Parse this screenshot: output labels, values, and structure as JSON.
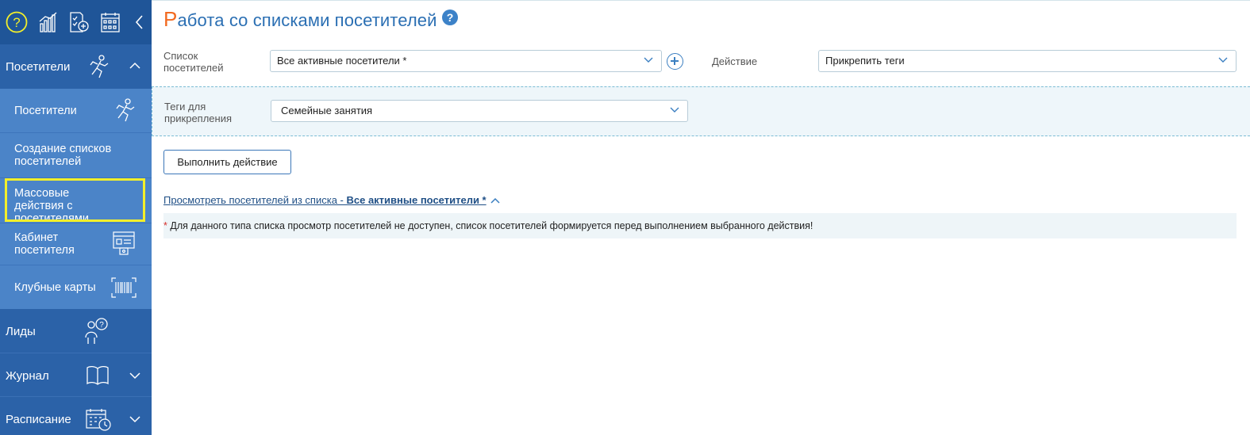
{
  "sidebar": {
    "toolbar": {
      "icons": [
        "help-icon",
        "stats-icon",
        "document-add-icon",
        "calendar-grid-icon",
        "collapse-arrow-icon"
      ]
    },
    "items": [
      {
        "label": "Посетители",
        "icon": "running-person-icon",
        "expanded": true
      },
      {
        "label": "Посетители",
        "icon": "running-person-icon"
      },
      {
        "label": "Создание списков посетителей"
      },
      {
        "label": "Массовые действия с посетителями",
        "highlighted": true
      },
      {
        "label": "Кабинет посетителя",
        "icon": "cabinet-icon"
      },
      {
        "label": "Клубные карты",
        "icon": "barcode-icon"
      },
      {
        "label": "Лиды",
        "icon": "person-question-icon"
      },
      {
        "label": "Журнал",
        "icon": "book-icon"
      },
      {
        "label": "Расписание",
        "icon": "schedule-icon"
      }
    ]
  },
  "page": {
    "title_first": "Р",
    "title_rest": "абота со списками посетителей",
    "help": "?"
  },
  "form": {
    "list_label": "Список посетителей",
    "list_value": "Все активные посетители *",
    "action_label": "Действие",
    "action_value": "Прикрепить теги",
    "tags_label": "Теги для прикрепления",
    "tags_value": "Семейные занятия",
    "execute_button": "Выполнить действие"
  },
  "view_link": {
    "prefix": "Просмотреть посетителей из списка - ",
    "list_name": "Все активные посетители *"
  },
  "note": {
    "star": "*",
    "text": " Для данного типа списка просмотр посетителей не доступен, список посетителей формируется перед выполнением выбранного действия!"
  },
  "colors": {
    "sidebar": "#2b62a8",
    "sidebar_sub": "#4b84c8",
    "highlight": "#f3ef2a",
    "title": "#2b6fb3",
    "title_accent": "#f26a21"
  }
}
